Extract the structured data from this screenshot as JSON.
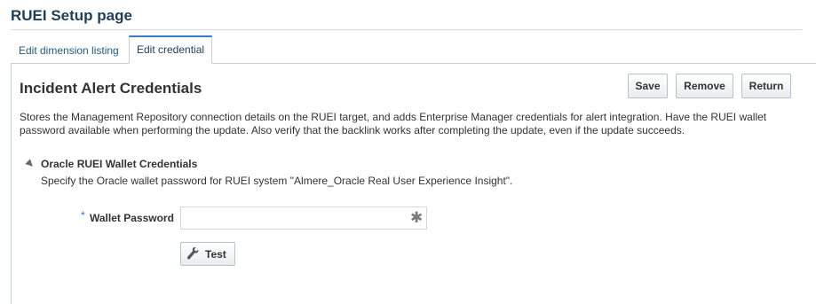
{
  "page": {
    "title": "RUEI Setup page"
  },
  "tabs": [
    {
      "label": "Edit dimension listing"
    },
    {
      "label": "Edit credential"
    }
  ],
  "section": {
    "title": "Incident Alert Credentials",
    "buttons": {
      "save": "Save",
      "remove": "Remove",
      "return": "Return"
    },
    "description": "Stores the Management Repository connection details on the RUEI target, and adds Enterprise Manager credentials for alert integration. Have the RUEI wallet password available when performing the update. Also verify that the backlink works after completing the update, even if the update succeeds."
  },
  "subsection": {
    "title": "Oracle RUEI Wallet Credentials",
    "description": "Specify the Oracle wallet password for RUEI system \"Almere_Oracle Real User Experience Insight\".",
    "field": {
      "required_mark": "*",
      "label": "Wallet Password",
      "value": "",
      "icon": "password-mask-icon"
    },
    "test_button": {
      "label": "Test",
      "icon": "wrench-icon"
    }
  }
}
